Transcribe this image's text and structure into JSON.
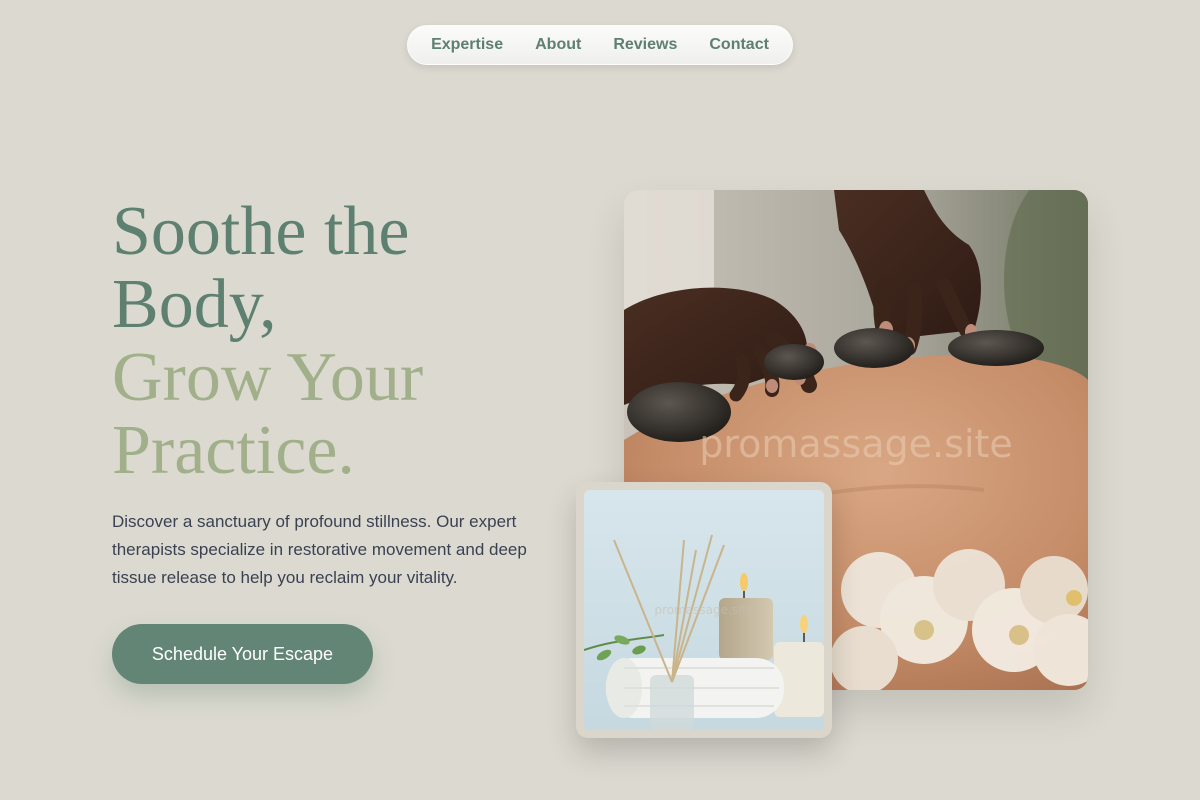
{
  "nav": {
    "items": [
      {
        "label": "Expertise"
      },
      {
        "label": "About"
      },
      {
        "label": "Reviews"
      },
      {
        "label": "Contact"
      }
    ]
  },
  "hero": {
    "title_line1": "Soothe the",
    "title_line2": "Body,",
    "title_line3": "Grow Your",
    "title_line4": "Practice.",
    "description": "Discover a sanctuary of profound stillness. Our expert therapists specialize in restorative movement and deep tissue release to help you reclaim your vitality.",
    "cta_label": "Schedule Your Escape"
  },
  "images": {
    "watermark": "promassage.site"
  },
  "colors": {
    "background": "#dcdad0",
    "accent_dark": "#5e8070",
    "accent_light": "#a1b08a",
    "button": "#638575",
    "body_text": "#3a4152"
  }
}
